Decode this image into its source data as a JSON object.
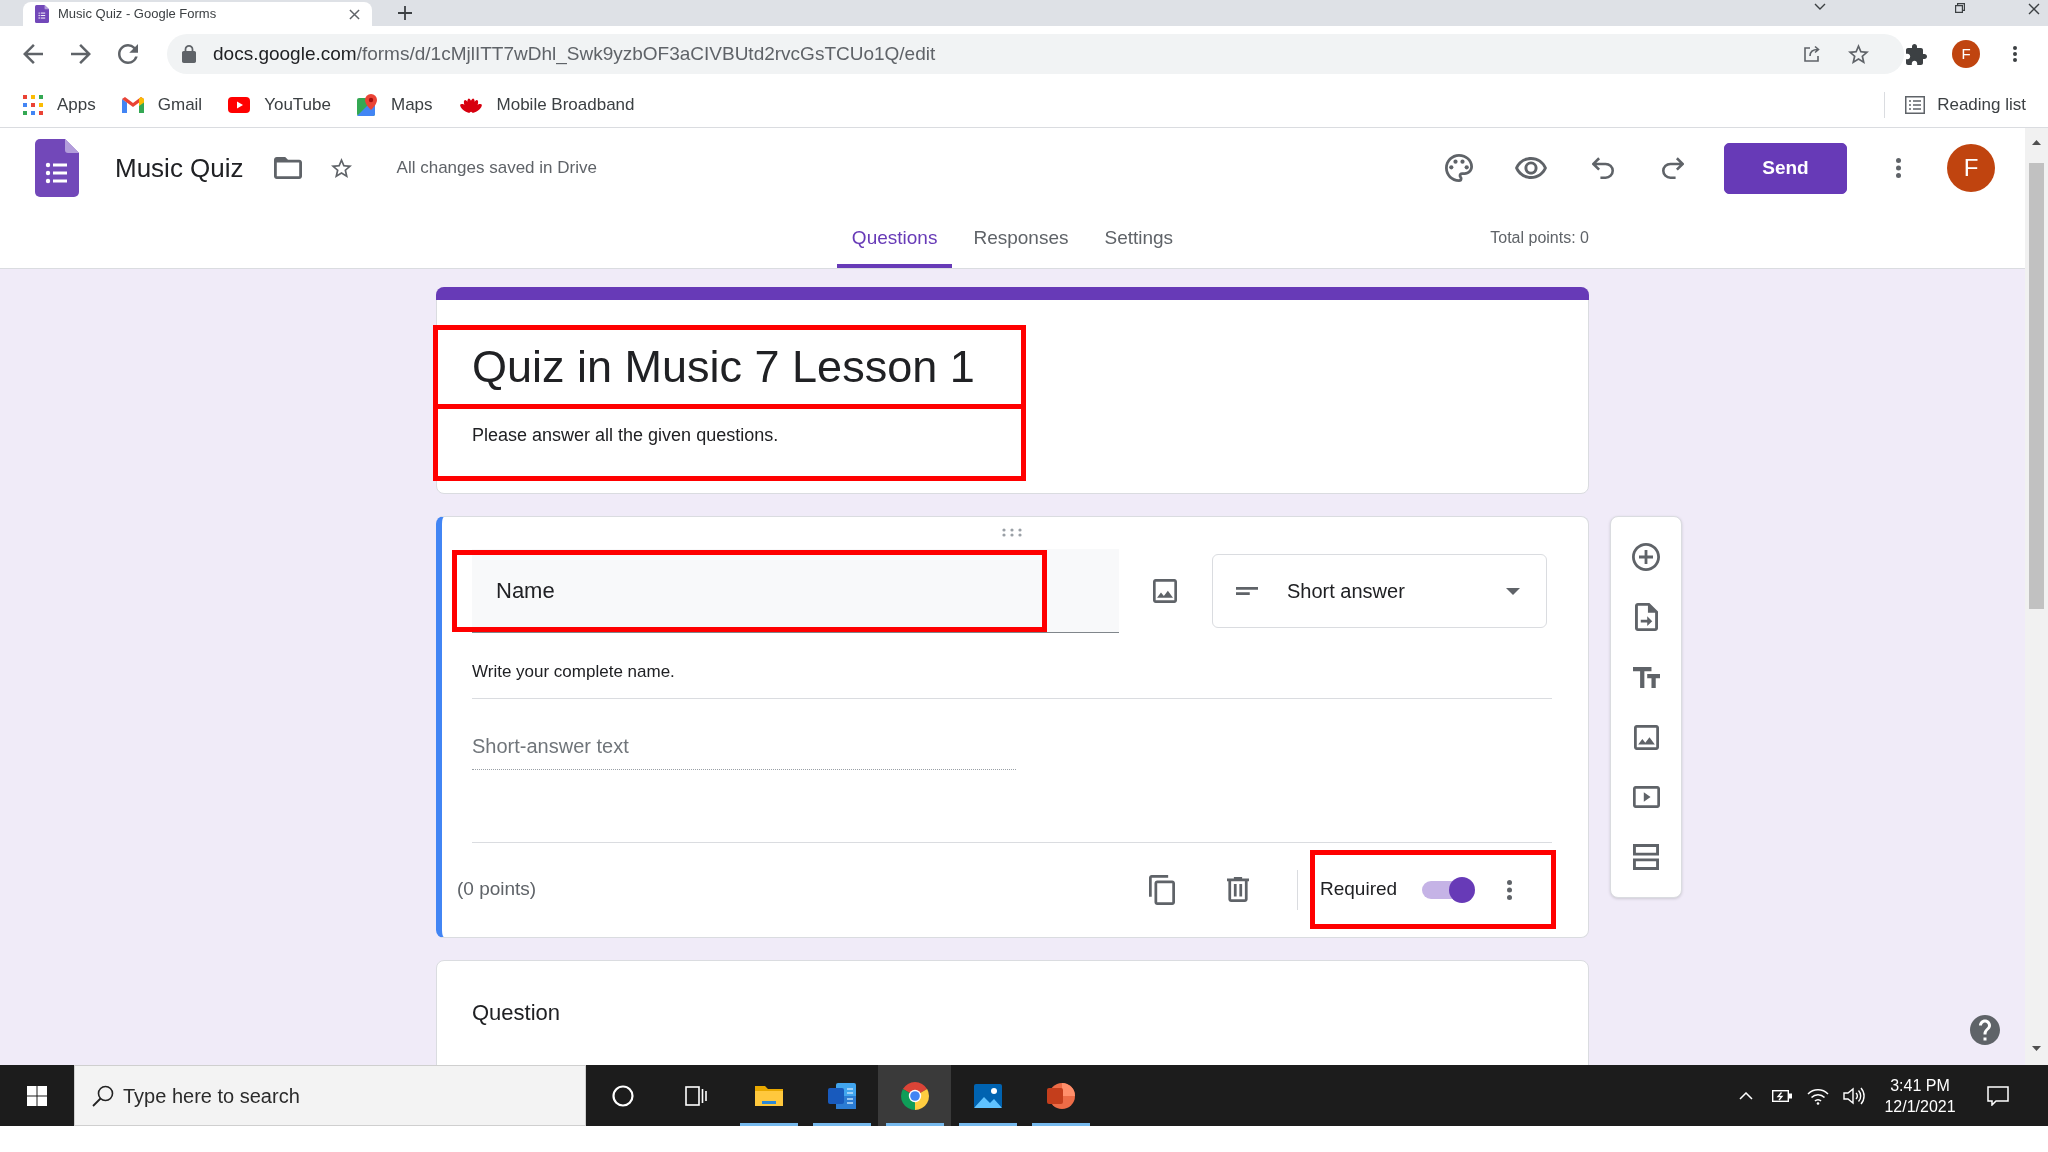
{
  "browser": {
    "tab_title": "Music Quiz - Google Forms",
    "url": {
      "host": "docs.google.com",
      "path": "/forms/d/1cMjlITT7wDhl_Swk9yzbOF3aCIVBUtd2rvcGsTCUo1Q/edit"
    },
    "profile_initial": "F",
    "bookmarks": [
      {
        "kind": "apps",
        "label": "Apps"
      },
      {
        "kind": "gmail",
        "label": "Gmail"
      },
      {
        "kind": "youtube",
        "label": "YouTube"
      },
      {
        "kind": "maps",
        "label": "Maps"
      },
      {
        "kind": "broadband",
        "label": "Mobile Broadband"
      }
    ],
    "reading_list": "Reading list"
  },
  "app": {
    "title": "Music Quiz",
    "save_status": "All changes saved in Drive",
    "send_button": "Send",
    "avatar_initial": "F"
  },
  "tabs": [
    {
      "label": "Questions",
      "selected": true
    },
    {
      "label": "Responses",
      "selected": false
    },
    {
      "label": "Settings",
      "selected": false
    }
  ],
  "total_points": "Total points: 0",
  "form": {
    "title": {
      "text": "Quiz in Music 7 Lesson 1",
      "highlighted": true
    },
    "description": {
      "text": "Please answer all the given questions.",
      "highlighted": true
    }
  },
  "questions": [
    {
      "selected": true,
      "title": {
        "text": "Name",
        "highlighted": true
      },
      "type": "Short answer",
      "description": "Write your complete name.",
      "placeholder": "Short-answer text",
      "points": "(0 points)",
      "required_label": "Required",
      "required": true,
      "required_highlighted": true
    },
    {
      "selected": false,
      "title": {
        "text": "Question",
        "highlighted": false
      }
    }
  ],
  "taskbar": {
    "search": {
      "placeholder": "Type here to search"
    },
    "apps": [
      {
        "kind": "explorer",
        "running": true,
        "active": false
      },
      {
        "kind": "word",
        "running": true,
        "active": false
      },
      {
        "kind": "chrome",
        "running": true,
        "active": true
      },
      {
        "kind": "photos",
        "running": true,
        "active": false
      },
      {
        "kind": "powerpoint",
        "running": true,
        "active": false
      }
    ],
    "time": "3:41 PM",
    "date": "12/1/2021"
  }
}
